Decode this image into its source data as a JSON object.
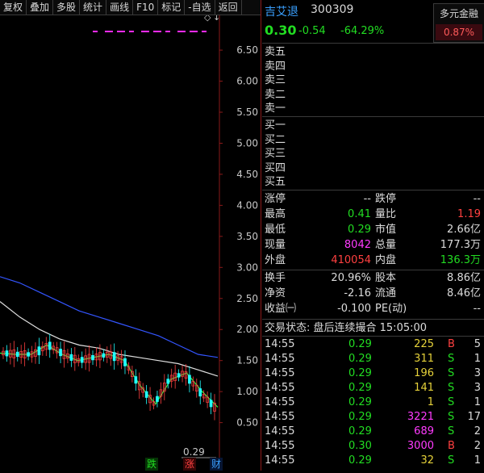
{
  "toolbar": {
    "items": [
      "复权",
      "叠加",
      "多股",
      "统计",
      "画线",
      "F10",
      "标记",
      "-自选",
      "返回"
    ]
  },
  "chart": {
    "y_ticks": [
      "6.50",
      "6.00",
      "5.50",
      "5.00",
      "4.50",
      "4.00",
      "3.50",
      "3.00",
      "2.50",
      "2.00",
      "1.50",
      "1.00",
      "0.50"
    ],
    "last_price_label": "0.29",
    "badges": {
      "fall": "跌",
      "rise": "涨",
      "finance": "财"
    },
    "colors": {
      "ma_long": "#3355ff",
      "ma_mid": "#e0e0e0",
      "ma_fast": "#ff40ff",
      "ma_green": "#22ff44",
      "marker": "#ff2bff"
    }
  },
  "chart_data": {
    "type": "line",
    "ylim": [
      0.3,
      6.8
    ],
    "series": [
      {
        "values": [
          2.85,
          2.75,
          2.6,
          2.45,
          2.3,
          2.2,
          2.1,
          2.0,
          1.9,
          1.75,
          1.6,
          1.55
        ]
      },
      {
        "values": [
          2.45,
          2.2,
          2.0,
          1.85,
          1.75,
          1.7,
          1.6,
          1.55,
          1.5,
          1.45,
          1.35,
          1.25
        ]
      },
      {
        "values": [
          1.62,
          1.6,
          1.6,
          1.75,
          1.6,
          1.5,
          1.55,
          1.6,
          1.5,
          1.1,
          0.8,
          1.2,
          1.3,
          1.0,
          0.75
        ]
      }
    ]
  },
  "header": {
    "name": "吉艾退",
    "code": "300309",
    "price": "0.30",
    "change": "-0.54",
    "change_pct": "-64.29%",
    "multi_label": "多元金融",
    "multi_value": "0.87%"
  },
  "orderbook": {
    "sell": [
      "卖五",
      "卖四",
      "卖三",
      "卖二",
      "卖一"
    ],
    "buy": [
      "买一",
      "买二",
      "买三",
      "买四",
      "买五"
    ]
  },
  "quote": {
    "rows": [
      {
        "l1": "涨停",
        "v1": "--",
        "c1": "white",
        "l2": "跌停",
        "v2": "--",
        "c2": "white"
      },
      {
        "l1": "最高",
        "v1": "0.41",
        "c1": "green",
        "l2": "量比",
        "v2": "1.19",
        "c2": "red"
      },
      {
        "l1": "最低",
        "v1": "0.29",
        "c1": "green",
        "l2": "市值",
        "v2": "2.66亿",
        "c2": "white"
      },
      {
        "l1": "现量",
        "v1": "8042",
        "c1": "magenta",
        "l2": "总量",
        "v2": "177.3万",
        "c2": "white"
      },
      {
        "l1": "外盘",
        "v1": "410054",
        "c1": "red",
        "l2": "内盘",
        "v2": "136.3万",
        "c2": "green"
      }
    ],
    "rows2": [
      {
        "l1": "换手",
        "v1": "20.96%",
        "c1": "white",
        "l2": "股本",
        "v2": "8.86亿",
        "c2": "white"
      },
      {
        "l1": "净资",
        "v1": "-2.16",
        "c1": "white",
        "l2": "流通",
        "v2": "8.46亿",
        "c2": "white"
      },
      {
        "l1": "收益㈠",
        "v1": "-0.100",
        "c1": "white",
        "l2": "PE(动)",
        "v2": "--",
        "c2": "white"
      }
    ]
  },
  "state_line": "交易状态: 盘后连续撮合 15:05:00",
  "ticks": [
    {
      "time": "14:55",
      "price": "0.29",
      "vol": "225",
      "vc": "yellow",
      "side": "B",
      "sc": "red",
      "n": "5"
    },
    {
      "time": "14:55",
      "price": "0.29",
      "vol": "311",
      "vc": "yellow",
      "side": "S",
      "sc": "green",
      "n": "1"
    },
    {
      "time": "14:55",
      "price": "0.29",
      "vol": "196",
      "vc": "yellow",
      "side": "S",
      "sc": "green",
      "n": "3"
    },
    {
      "time": "14:55",
      "price": "0.29",
      "vol": "141",
      "vc": "yellow",
      "side": "S",
      "sc": "green",
      "n": "3"
    },
    {
      "time": "14:55",
      "price": "0.29",
      "vol": "1",
      "vc": "yellow",
      "side": "S",
      "sc": "green",
      "n": "1"
    },
    {
      "time": "14:55",
      "price": "0.29",
      "vol": "3221",
      "vc": "magenta",
      "side": "S",
      "sc": "green",
      "n": "17"
    },
    {
      "time": "14:55",
      "price": "0.29",
      "vol": "689",
      "vc": "magenta",
      "side": "S",
      "sc": "green",
      "n": "2"
    },
    {
      "time": "14:55",
      "price": "0.30",
      "vol": "3000",
      "vc": "magenta",
      "side": "B",
      "sc": "red",
      "n": "2"
    },
    {
      "time": "14:55",
      "price": "0.29",
      "vol": "32",
      "vc": "yellow",
      "side": "S",
      "sc": "green",
      "n": "1"
    }
  ]
}
